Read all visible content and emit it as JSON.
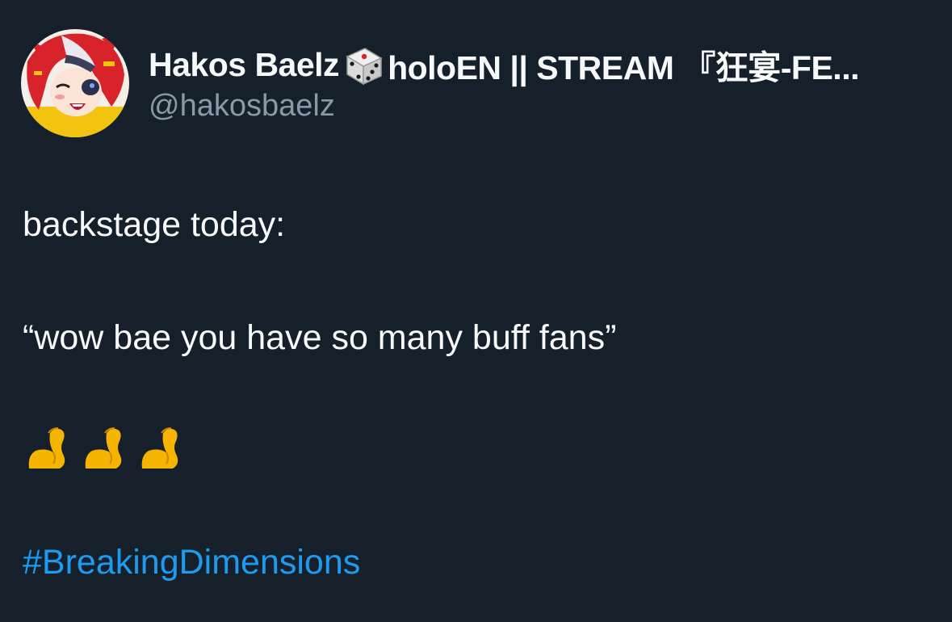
{
  "author": {
    "display_name_pre": "Hakos Baelz",
    "display_name_post": "holoEN || STREAM 『狂宴-FE...",
    "handle": "@hakosbaelz",
    "avatar_icon": "avatar-image",
    "name_emoji_icon": "dice-icon"
  },
  "tweet": {
    "line1": "backstage today:",
    "line2": "“wow bae you have so many buff fans”",
    "emojis": [
      "flexed-biceps-icon",
      "flexed-biceps-icon",
      "flexed-biceps-icon"
    ],
    "hashtag": "#BreakingDimensions"
  },
  "colors": {
    "background": "#15202b",
    "text": "#f7f9f9",
    "secondary_text": "#8b98a5",
    "link": "#1d9bf0"
  }
}
